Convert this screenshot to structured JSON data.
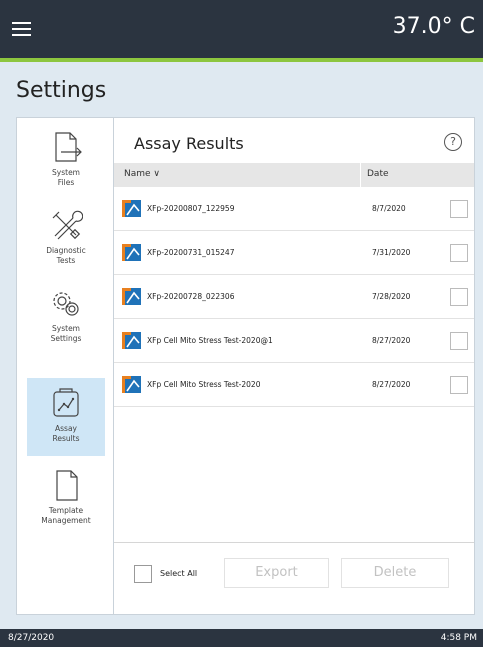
{
  "header": {
    "temperature": "37.0° C"
  },
  "page": {
    "title": "Settings"
  },
  "sidebar": {
    "items": [
      {
        "label": "System\nFiles",
        "icon": "system-files-icon"
      },
      {
        "label": "Diagnostic\nTests",
        "icon": "diagnostic-tools-icon"
      },
      {
        "label": "System\nSettings",
        "icon": "gears-icon"
      },
      {
        "label": "Assay\nResults",
        "icon": "line-chart-icon",
        "active": true
      },
      {
        "label": "Template\nManagement",
        "icon": "document-icon"
      }
    ]
  },
  "main": {
    "title": "Assay Results",
    "help": "?",
    "columns": {
      "name": "Name ∨",
      "date": "Date"
    },
    "rows": [
      {
        "name": "XFp-20200807_122959",
        "date": "8/7/2020"
      },
      {
        "name": "XFp-20200731_015247",
        "date": "7/31/2020"
      },
      {
        "name": "XFp-20200728_022306",
        "date": "7/28/2020"
      },
      {
        "name": "XFp Cell Mito Stress Test-2020@1",
        "date": "8/27/2020"
      },
      {
        "name": "XFp Cell Mito Stress Test-2020",
        "date": "8/27/2020"
      }
    ],
    "select_all_label": "Select All",
    "export_label": "Export",
    "delete_label": "Delete"
  },
  "status": {
    "date": "8/27/2020",
    "time": "4:58 PM"
  },
  "colors": {
    "topbar": "#2b3440",
    "accent": "#8dc63f",
    "active_item": "#cfe6f6",
    "file_icon_blue": "#1f72b8",
    "file_icon_orange": "#e8801f"
  }
}
